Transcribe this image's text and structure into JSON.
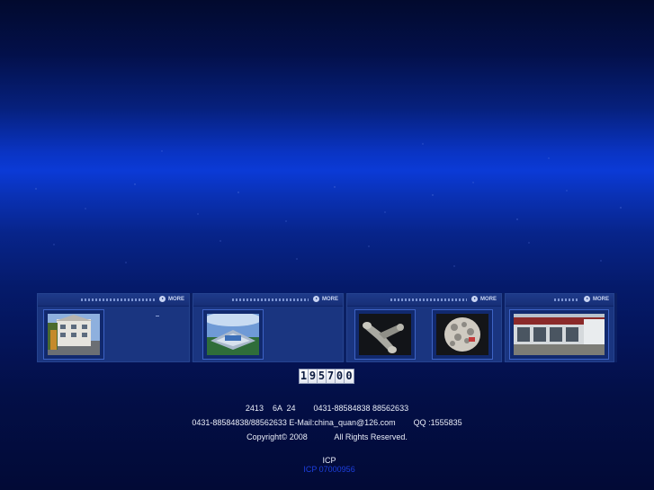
{
  "colors": {
    "link": "#1d3fe0",
    "text": "#e9edf8",
    "panel": "#152d76"
  },
  "gallery": {
    "more_label": "MORE",
    "panels": [
      {
        "thumbs": [
          {
            "icon": "building-photo"
          }
        ],
        "note": ""
      },
      {
        "thumbs": [
          {
            "icon": "factory-aerial-photo"
          }
        ]
      },
      {
        "thumbs": [
          {
            "icon": "pipe-fitting-photo"
          },
          {
            "icon": "fittings-bag-photo"
          }
        ]
      },
      {
        "thumbs": [
          {
            "icon": "storefront-photo"
          }
        ]
      }
    ]
  },
  "counter": {
    "digits": [
      "1",
      "9",
      "5",
      "7",
      "0",
      "0"
    ]
  },
  "footer": {
    "line1": "2413    6A  24        0431-88584838 88562633",
    "line2": "0431-88584838/88562633 E-Mail:china_quan@126.com        QQ :1555835",
    "line3": "Copyright© 2008            All Rights Reserved.",
    "icp_label": "ICP",
    "icp_link": "ICP 07000956"
  }
}
